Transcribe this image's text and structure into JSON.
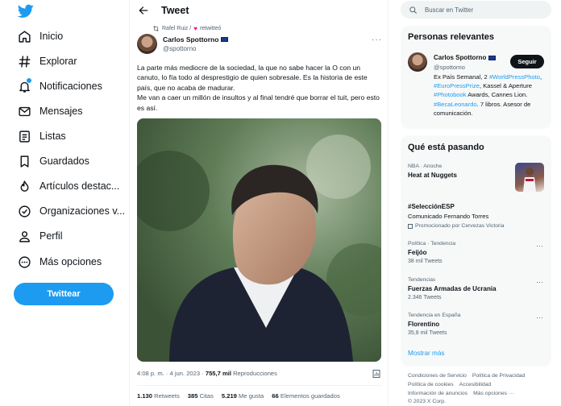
{
  "sidebar": {
    "logo": "twitter-bird-icon",
    "items": [
      {
        "label": "Inicio",
        "icon": "home-icon"
      },
      {
        "label": "Explorar",
        "icon": "hashtag-icon"
      },
      {
        "label": "Notificaciones",
        "icon": "bell-icon"
      },
      {
        "label": "Mensajes",
        "icon": "mail-icon"
      },
      {
        "label": "Listas",
        "icon": "list-icon"
      },
      {
        "label": "Guardados",
        "icon": "bookmark-icon"
      },
      {
        "label": "Artículos destac...",
        "icon": "flame-icon"
      },
      {
        "label": "Organizaciones v...",
        "icon": "verified-icon"
      },
      {
        "label": "Perfil",
        "icon": "person-icon"
      },
      {
        "label": "Más opciones",
        "icon": "more-circle-icon"
      }
    ],
    "tweet_button": "Twittear"
  },
  "tweet": {
    "header_title": "Tweet",
    "retweeted_by": "Rafel Ruiz / ",
    "retweeted_suffix": "retwitteó",
    "author_name": "Carlos Spottorno",
    "author_handle": "@spottorno",
    "more": "···",
    "text_1": "La parte más mediocre de la sociedad, la que no sabe hacer la O con un canuto, lo fía todo al desprestigio de quien sobresale. Es la historia de este país, que no acaba de madurar.",
    "text_2": "Me van a caer un millón de insultos y al final tendré que borrar el tuit, pero esto es así.",
    "time": "4:08 p. m. · 4 jun. 2023 · ",
    "views": "755,7 mil",
    "views_label": "Reproducciones",
    "stats": {
      "retweets": "1.130",
      "retweets_label": "Retweets",
      "quotes": "385",
      "quotes_label": "Citas",
      "likes": "5.219",
      "likes_label": "Me gusta",
      "bookmarks": "66",
      "bookmarks_label": "Elementos guardados"
    }
  },
  "right": {
    "search_placeholder": "Buscar en Twitter",
    "relevant": {
      "title": "Personas relevantes",
      "name": "Carlos Spottorno",
      "handle": "@spottorno",
      "follow": "Seguir",
      "bio_1": "Ex País Semanal, 2 ",
      "bio_link_1": "#WorldPressPhoto",
      "bio_2": ", ",
      "bio_link_2": "#EuroPressPrize",
      "bio_3": ", Kassel & Aperture ",
      "bio_link_3": "#Photobook",
      "bio_4": " Awards, Cannes Lion. ",
      "bio_link_4": "#BecaLeonardo",
      "bio_5": ". 7 libros. Asesor de comunicación."
    },
    "trending": {
      "title": "Qué está pasando",
      "items": [
        {
          "context": "NBA · Anoche",
          "name": "Heat at Nuggets"
        },
        {
          "name": "#SelecciónESP",
          "sub": "Comunicado Fernando Torres",
          "promo": "Promocionado por Cervezas Victoria"
        },
        {
          "context": "Política · Tendencia",
          "name": "Feijóo",
          "sub": "38 mil Tweets"
        },
        {
          "context": "Tendencias",
          "name": "Fuerzas Armadas de Ucrania",
          "sub": "2.346 Tweets"
        },
        {
          "context": "Tendencia en España",
          "name": "Florentino",
          "sub": "35,8 mil Tweets"
        }
      ],
      "show_more": "Mostrar más"
    },
    "footer": {
      "links": [
        "Condiciones de Servicio",
        "Política de Privacidad",
        "Política de cookies",
        "Accesibilidad",
        "Información de anuncios",
        "Más opciones ···"
      ],
      "copyright": "© 2023 X Corp."
    }
  },
  "colors": {
    "accent": "#1d9bf0",
    "text": "#0f1419",
    "muted": "#536471",
    "panel": "#f7f9f9"
  }
}
